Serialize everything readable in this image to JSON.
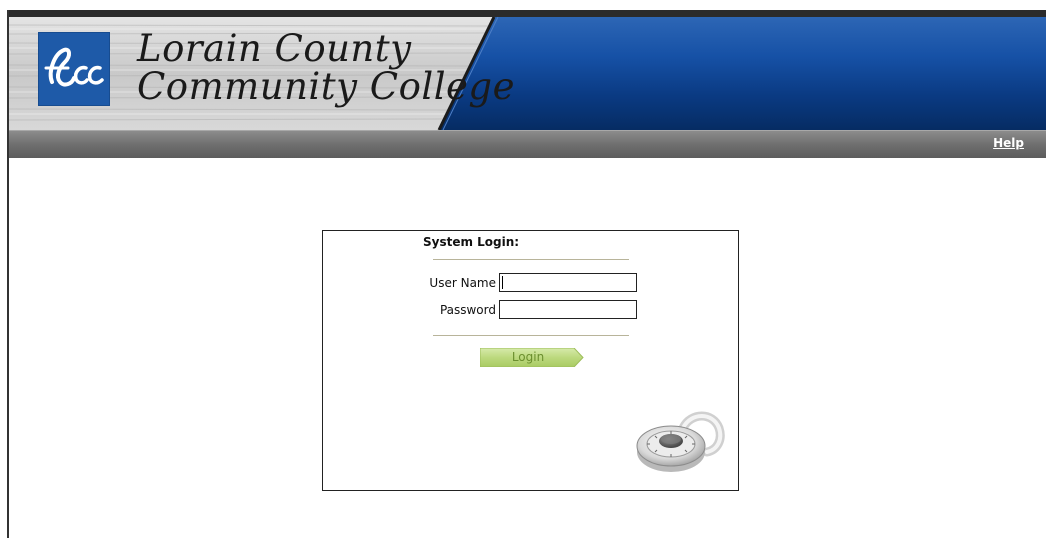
{
  "header": {
    "college_name_line1": "Lorain County",
    "college_name_line2": "Community College",
    "logo_text": "Lcc",
    "colors": {
      "banner_blue": "#0d3f8d",
      "logo_blue": "#1e5aa8",
      "nav_gray": "#6f6f6f"
    }
  },
  "nav": {
    "help_label": "Help"
  },
  "login": {
    "title": "System Login:",
    "username_label": "User Name",
    "username_value": "",
    "password_label": "Password",
    "password_value": "",
    "button_label": "Login",
    "icons": {
      "decoration": "padlock-icon"
    },
    "colors": {
      "button_green": "#b9d77a",
      "divider": "#b8b49a"
    }
  }
}
